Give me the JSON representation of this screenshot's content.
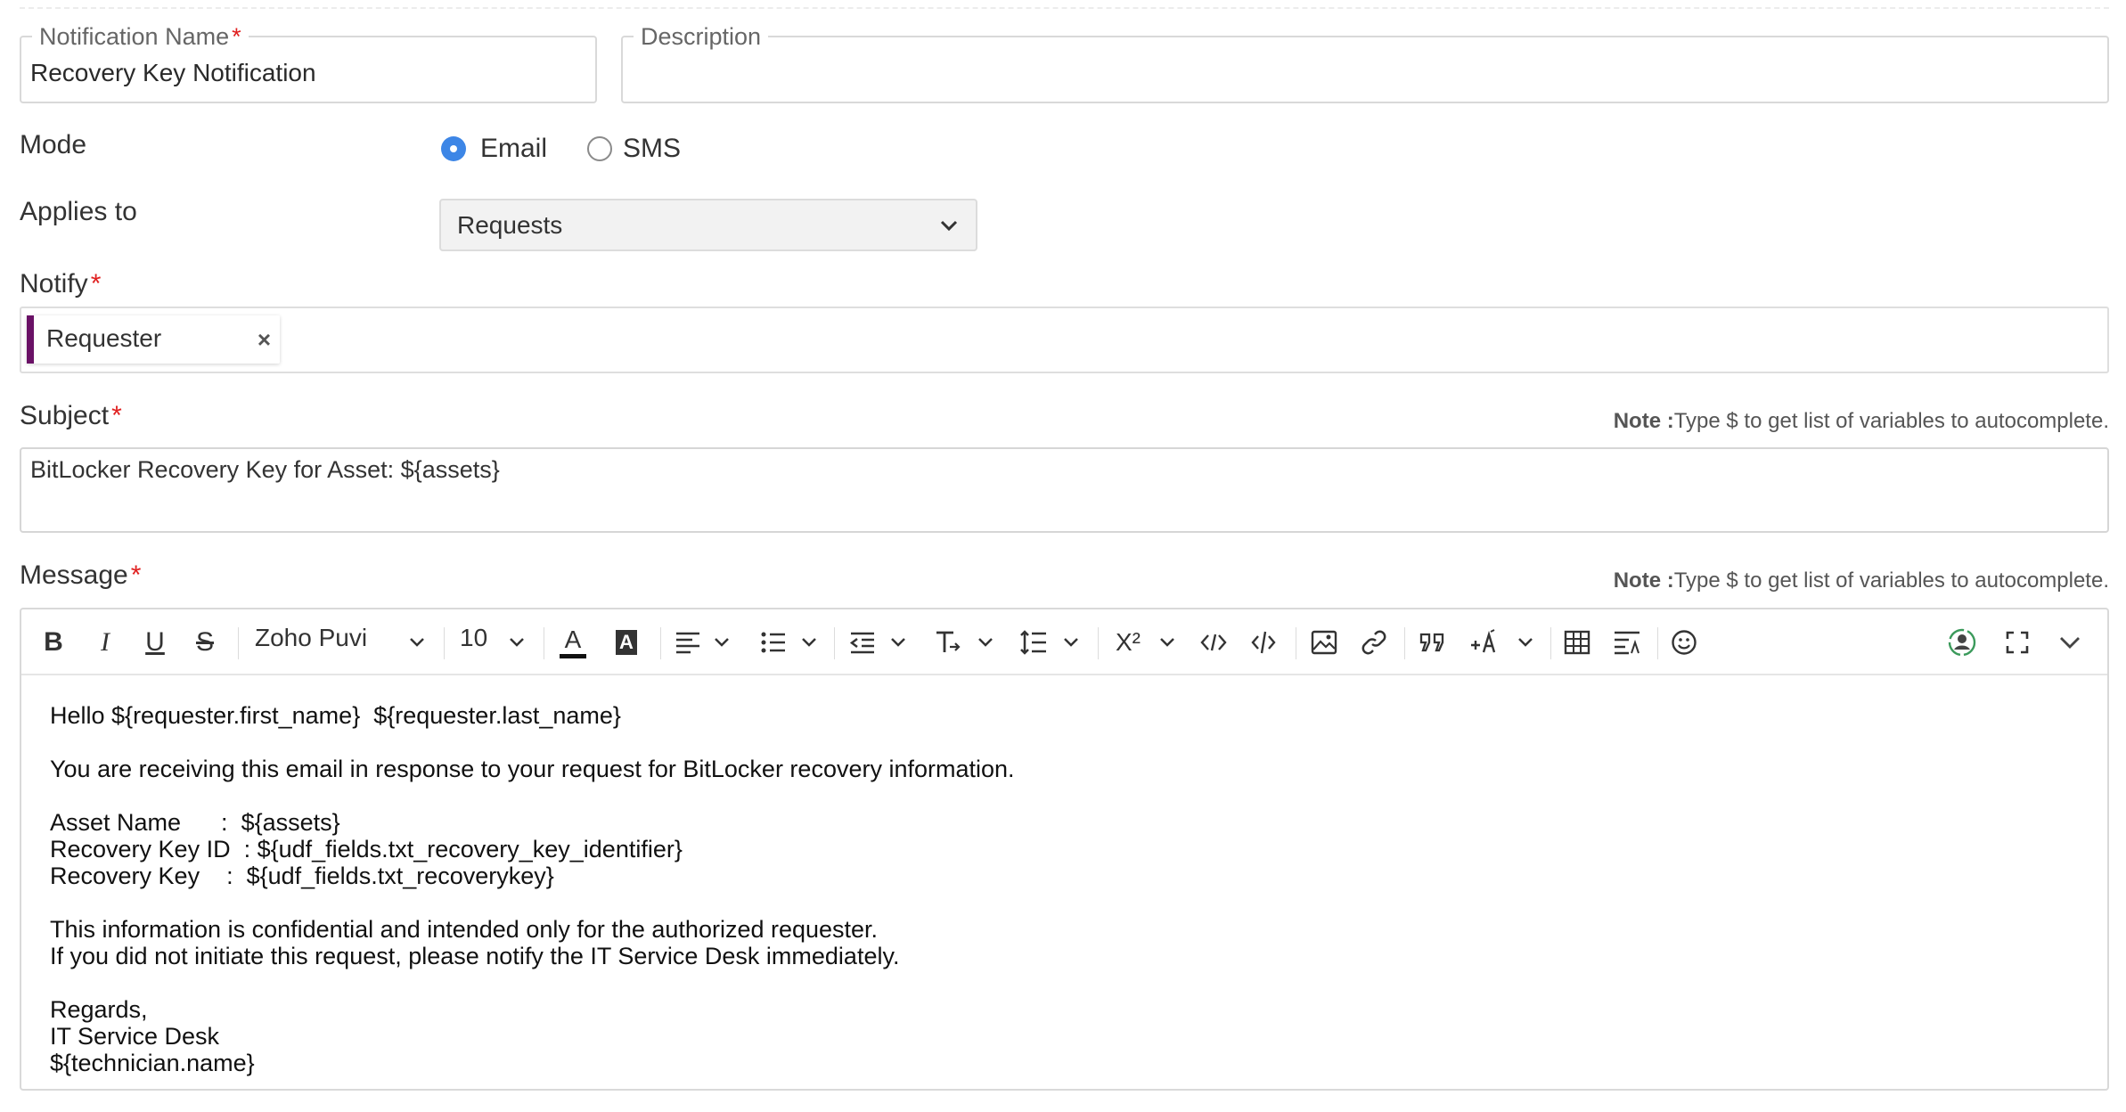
{
  "form": {
    "notification_name": {
      "label": "Notification Name",
      "required_mark": "*",
      "value": "Recovery Key Notification"
    },
    "description": {
      "label": "Description",
      "value": ""
    },
    "mode": {
      "label": "Mode",
      "options": [
        {
          "label": "Email",
          "selected": true
        },
        {
          "label": "SMS",
          "selected": false
        }
      ]
    },
    "applies_to": {
      "label": "Applies to",
      "value": "Requests"
    },
    "notify": {
      "label": "Notify",
      "required_mark": "*",
      "chips": [
        {
          "label": "Requester",
          "remove": "×",
          "color": "#6a1166"
        }
      ]
    },
    "subject": {
      "label": "Subject",
      "required_mark": "*",
      "value": "BitLocker Recovery Key for Asset: ${assets}",
      "note_bold": "Note :",
      "note": "Type $ to get list of variables to autocomplete."
    },
    "message": {
      "label": "Message",
      "required_mark": "*",
      "note_bold": "Note :",
      "note": "Type $ to get list of variables to autocomplete."
    }
  },
  "toolbar": {
    "bold": "B",
    "italic": "I",
    "underline": "U",
    "strike": "S",
    "font_family": "Zoho Puvi",
    "font_size": "10",
    "font_color": "A",
    "bg_color": "A",
    "superscript": "X²"
  },
  "message_body": {
    "lines": [
      "Hello ${requester.first_name}  ${requester.last_name}",
      "",
      "You are receiving this email in response to your request for BitLocker recovery information.",
      "",
      "Asset Name      :  ${assets}",
      "Recovery Key ID  : ${udf_fields.txt_recovery_key_identifier}",
      "Recovery Key    :  ${udf_fields.txt_recoverykey}",
      "",
      "This information is confidential and intended only for the authorized requester.",
      "If you did not initiate this request, please notify the IT Service Desk immediately.",
      "",
      "Regards,",
      "IT Service Desk",
      "${technician.name}"
    ]
  },
  "colors": {
    "accent": "#3d86e6",
    "required": "#e02020",
    "chip_bar": "#6a1166"
  }
}
